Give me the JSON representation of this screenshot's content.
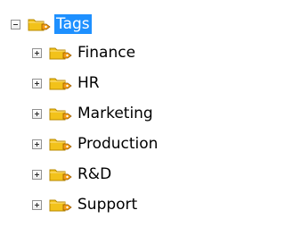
{
  "tree": {
    "root": {
      "label": "Tags",
      "expanded": true,
      "selected": true,
      "icon": "tag-folder-icon",
      "toggle": "minus"
    },
    "children": [
      {
        "label": "Finance",
        "icon": "tag-folder-icon",
        "toggle": "plus"
      },
      {
        "label": "HR",
        "icon": "tag-folder-icon",
        "toggle": "plus"
      },
      {
        "label": "Marketing",
        "icon": "tag-folder-icon",
        "toggle": "plus"
      },
      {
        "label": "Production",
        "icon": "tag-folder-icon",
        "toggle": "plus"
      },
      {
        "label": "R&D",
        "icon": "tag-folder-icon",
        "toggle": "plus"
      },
      {
        "label": "Support",
        "icon": "tag-folder-icon",
        "toggle": "plus"
      }
    ]
  },
  "colors": {
    "selection": "#1e90ff",
    "folder": "#f2c21a",
    "folder_border": "#b88a00",
    "tag": "#f39c12"
  }
}
